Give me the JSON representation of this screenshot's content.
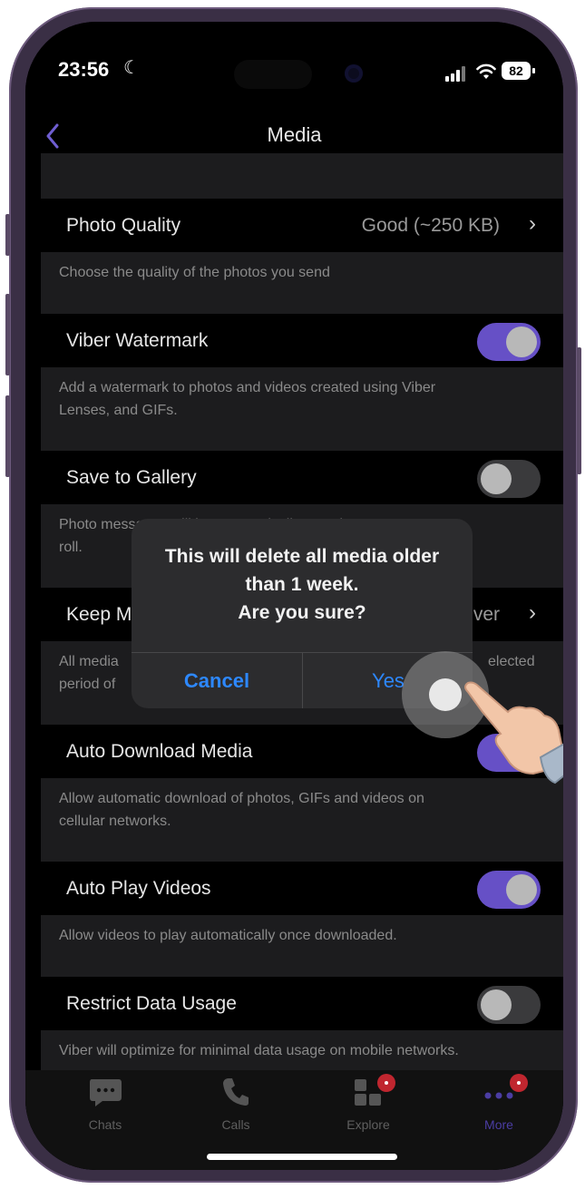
{
  "status": {
    "time": "23:56",
    "battery": "82"
  },
  "nav": {
    "back_icon": "chevron-left-icon",
    "title": "Media"
  },
  "settings": {
    "photo_quality": {
      "label": "Photo Quality",
      "value": "Good (~250 KB)",
      "description": "Choose the quality of the photos you send"
    },
    "watermark": {
      "label": "Viber Watermark",
      "on": true,
      "description_1": "Add a watermark to photos and videos created using Viber",
      "description_2": "Lenses, and GIFs."
    },
    "save_gallery": {
      "label": "Save to Gallery",
      "on": false,
      "description_1": "Photo messages will be automatically saved to your camera",
      "description_2": "roll."
    },
    "keep_media": {
      "label_partial": "Keep M",
      "value_partial": "ver",
      "description_1_left": "All media",
      "description_1_right": "elected",
      "description_2_left": "period of"
    },
    "auto_download": {
      "label": "Auto Download Media",
      "description_1": "Allow automatic download of photos, GIFs and videos on",
      "description_2": "cellular networks."
    },
    "auto_play": {
      "label": "Auto Play Videos",
      "on": true,
      "description": "Allow videos to play automatically once downloaded."
    },
    "restrict_data": {
      "label": "Restrict Data Usage",
      "on": false,
      "description": "Viber will optimize for minimal data usage on mobile networks."
    }
  },
  "dialog": {
    "line1": "This will delete all media older",
    "line2": "than 1 week.",
    "line3": "Are you sure?",
    "cancel": "Cancel",
    "yes": "Yes"
  },
  "tabs": [
    {
      "label": "Chats",
      "icon": "chat-bubble-icon"
    },
    {
      "label": "Calls",
      "icon": "phone-icon"
    },
    {
      "label": "Explore",
      "icon": "explore-icon"
    },
    {
      "label": "More",
      "icon": "more-dots-icon"
    }
  ],
  "colors": {
    "accent": "#6650c6",
    "link": "#2d88ff",
    "badge": "#c0262f"
  }
}
